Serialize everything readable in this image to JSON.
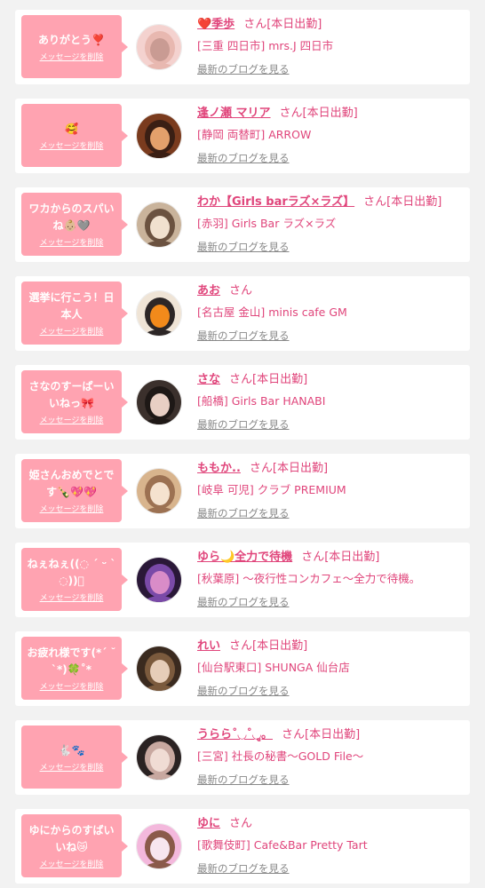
{
  "delete_label": "メッセージを削除",
  "blog_label": "最新のブログを見る",
  "san_label": "さん",
  "cards": [
    {
      "message": "ありがとう❣️",
      "name": "❤️季歩",
      "status": "[本日出勤]",
      "shop": "[三重 四日市] mrs.J 四日市",
      "avatar_icon": "avatar-photo-icon",
      "avatar_colors": [
        "#f4d2cf",
        "#c99b93",
        "#e8b8b0"
      ]
    },
    {
      "message": "🥰",
      "name": "逢ノ瀬 マリア",
      "status": "[本日出勤]",
      "shop": "[静岡 両替町] ARROW",
      "avatar_icon": "avatar-photo-icon",
      "avatar_colors": [
        "#7a3b1e",
        "#e3a06b",
        "#3a1f14"
      ]
    },
    {
      "message": "ワカからのスパいね👶🏼🩶",
      "name": "わか【Girls barラズ×ラズ】",
      "status": "[本日出勤]",
      "shop": "[赤羽] Girls Bar ラズ×ラズ",
      "avatar_icon": "avatar-photo-icon",
      "avatar_colors": [
        "#c9b39b",
        "#f1e1cf",
        "#6b5240"
      ]
    },
    {
      "message": "選挙に行こう！日本人",
      "name": "あお",
      "status": "",
      "shop": "[名古屋 金山] minis cafe GM",
      "avatar_icon": "avatar-photo-icon",
      "avatar_colors": [
        "#efe4d6",
        "#f28a1b",
        "#2c2626"
      ]
    },
    {
      "message": "さなのすーぱーいいねっ🎀",
      "name": "さな",
      "status": "[本日出勤]",
      "shop": "[船橋] Girls Bar HANABI",
      "avatar_icon": "avatar-photo-icon",
      "avatar_colors": [
        "#3b302c",
        "#e8cfc4",
        "#1e1816"
      ]
    },
    {
      "message": "姫さんおめでとです🍾💖💖",
      "name": "ももか..",
      "status": "[本日出勤]",
      "shop": "[岐阜 可児] クラブ PREMIUM",
      "avatar_icon": "avatar-photo-icon",
      "avatar_colors": [
        "#d8b48d",
        "#f5e2cf",
        "#9c7152"
      ]
    },
    {
      "message": "ねぇねぇ((◌ ˊ ᵕ ˋ ◌))ﾟ",
      "name": "ゆら🌙全力で待機",
      "status": "[本日出勤]",
      "shop": "[秋葉原] 〜夜行性コンカフェ〜全力で待機。",
      "avatar_icon": "avatar-photo-icon",
      "avatar_colors": [
        "#2a1838",
        "#d98cc8",
        "#7a4aa8"
      ]
    },
    {
      "message": "お疲れ様です(*´ ˘ `*)🍀˚*",
      "name": "れい",
      "status": "[本日出勤]",
      "shop": "[仙台駅東口] SHUNGA 仙台店",
      "avatar_icon": "avatar-photo-icon",
      "avatar_colors": [
        "#3a2a1f",
        "#e6cdb9",
        "#7b5a3d"
      ]
    },
    {
      "message": "🐇🐾",
      "name": "うらら˚◡˚◡ู。",
      "status": "[本日出勤]",
      "shop": "[三宮] 社長の秘書〜GOLD File〜",
      "avatar_icon": "avatar-photo-icon",
      "avatar_colors": [
        "#2a2222",
        "#f0dcd4",
        "#c8a8a0"
      ]
    },
    {
      "message": "ゆにからのすばいいね😿",
      "name": "ゆに",
      "status": "",
      "shop": "[歌舞伎町] Cafe&Bar Pretty Tart",
      "avatar_icon": "avatar-photo-icon",
      "avatar_colors": [
        "#f3b8dc",
        "#f7e6ef",
        "#8a5a4a"
      ]
    }
  ]
}
